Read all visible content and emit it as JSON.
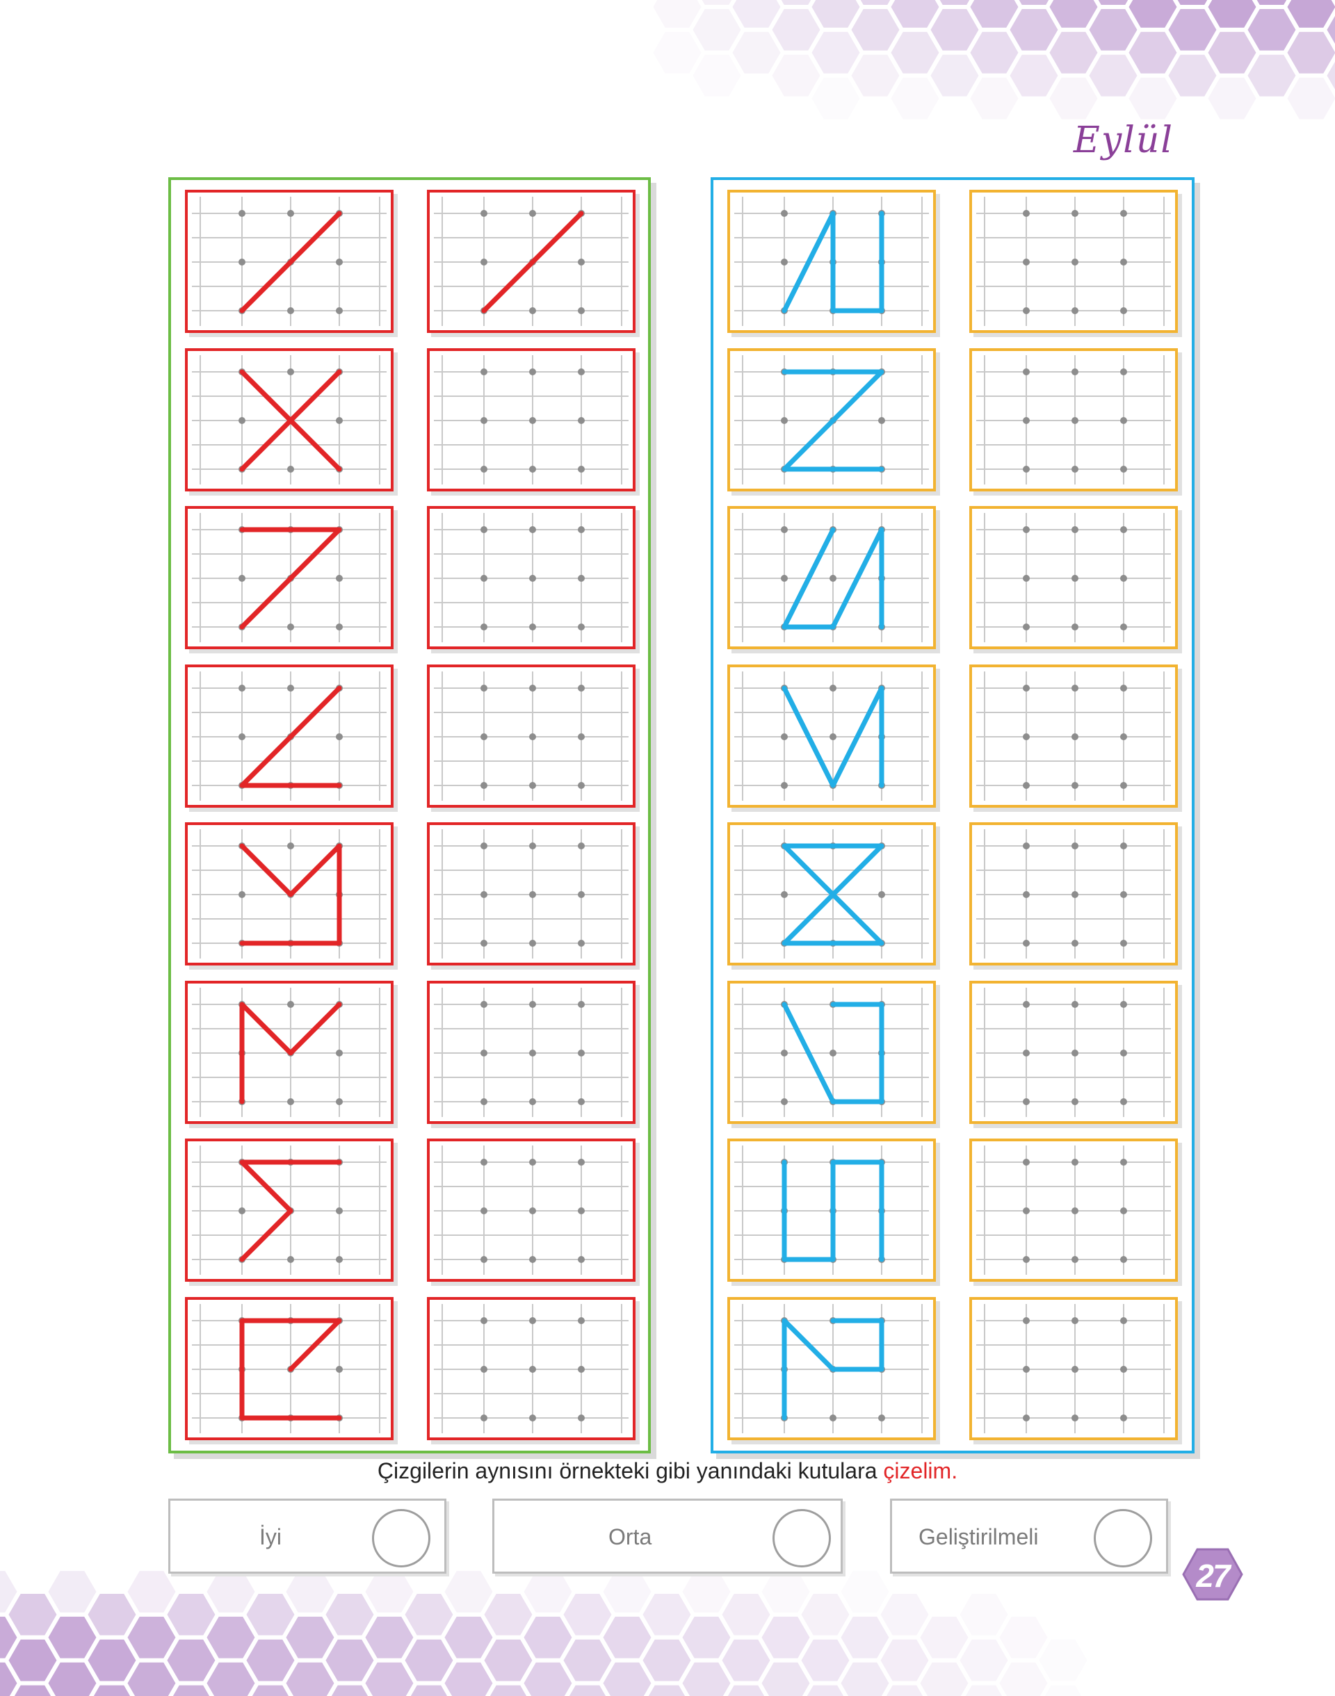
{
  "header": {
    "month": "Eylül"
  },
  "colors": {
    "left_panel_border": "#6cbd45",
    "right_panel_border": "#22aee6",
    "left_cell_border": "#e22527",
    "right_cell_border": "#f2b331",
    "left_stroke": "#e22527",
    "right_stroke": "#22aee6",
    "hexagon": "#c6a7d6"
  },
  "worksheet": {
    "grid": {
      "columns": 3,
      "rows": 3,
      "dot_color": "#8d8d8d"
    },
    "left_examples": [
      [
        "M0 2 L2 0"
      ],
      [
        "M0 0 L2 2",
        "M2 0 L0 2"
      ],
      [
        "M0 0 L2 0 L0 2"
      ],
      [
        "M2 0 L0 2 L2 2"
      ],
      [
        "M0 0 L1 1 L2 0 L2 2 L0 2"
      ],
      [
        "M0 2 L0 0 L1 1 L2 0"
      ],
      [
        "M2 0 L0 0 L1 1 L0 2"
      ],
      [
        "M1 1 L2 0 L0 0 L0 2 L2 2"
      ]
    ],
    "right_examples": [
      [
        "M0 2 L1 0 L1 2 L2 2 L2 0"
      ],
      [
        "M0 0 L2 0 L0 2 L2 2"
      ],
      [
        "M0 2 L1 2 L2 0 L2 2",
        "M0 2 L1 0"
      ],
      [
        "M0 0 L1 2 L2 0 L2 2"
      ],
      [
        "M0 0 L2 0 L0 2 L2 2 L0 0"
      ],
      [
        "M0 0 L1 2 L2 2 L2 0 L1 0"
      ],
      [
        "M0 2 L0 0 L0 2 L1 2 L1 0 L2 0 L2 2"
      ],
      [
        "M0 2 L0 0 L1 1 L2 1 L2 0 L1 0"
      ]
    ]
  },
  "instruction": {
    "text": "Çizgilerin aynısını örnekteki gibi yanındaki kutulara ",
    "highlight": "çizelim."
  },
  "rating": {
    "good": "İyi",
    "medium": "Orta",
    "improve": "Geliştirilmeli"
  },
  "page_number": "27"
}
